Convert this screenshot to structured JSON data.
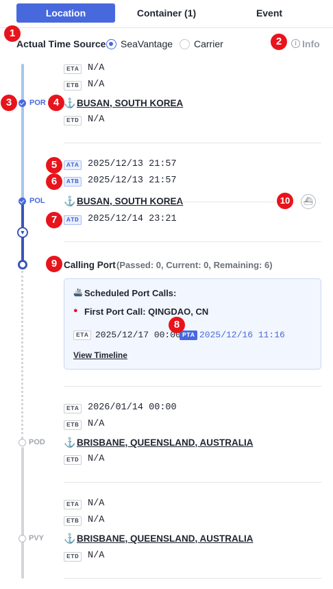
{
  "tabs": [
    {
      "label": "Location",
      "active": true
    },
    {
      "label": "Container (1)",
      "active": false
    },
    {
      "label": "Event",
      "active": false
    }
  ],
  "time_source": {
    "label": "Actual Time Source:",
    "options": [
      {
        "label": "SeaVantage",
        "selected": true
      },
      {
        "label": "Carrier",
        "selected": false
      }
    ],
    "info_label": "Info",
    "info_icon": "info-circle-icon"
  },
  "markers": [
    "1",
    "2",
    "3",
    "4",
    "5",
    "6",
    "7",
    "8",
    "9",
    "10"
  ],
  "stages": {
    "por": {
      "label": "POR",
      "rows": [
        {
          "badge": "ETA",
          "value": "N/A"
        },
        {
          "badge": "ETB",
          "value": "N/A"
        }
      ],
      "port": "BUSAN, SOUTH KOREA",
      "after": [
        {
          "badge": "ETD",
          "value": "N/A"
        }
      ]
    },
    "pol": {
      "label": "POL",
      "rows": [
        {
          "badge": "ATA",
          "value": "2025/12/13 21:57"
        },
        {
          "badge": "ATB",
          "value": "2025/12/13 21:57"
        }
      ],
      "port": "BUSAN, SOUTH KOREA",
      "after": [
        {
          "badge": "ATD",
          "value": "2025/12/14 23:21"
        }
      ]
    },
    "pod": {
      "label": "POD",
      "rows": [
        {
          "badge": "ETA",
          "value": "2026/01/14 00:00"
        },
        {
          "badge": "ETB",
          "value": "N/A"
        }
      ],
      "port": "BRISBANE, QUEENSLAND, AUSTRALIA",
      "after": [
        {
          "badge": "ETD",
          "value": "N/A"
        }
      ]
    },
    "pvy": {
      "label": "PVY",
      "rows": [
        {
          "badge": "ETA",
          "value": "N/A"
        },
        {
          "badge": "ETB",
          "value": "N/A"
        }
      ],
      "port": "BRISBANE, QUEENSLAND, AUSTRALIA",
      "after": [
        {
          "badge": "ETD",
          "value": "N/A"
        }
      ]
    }
  },
  "calling_port": {
    "title": "Calling Port",
    "meta": "(Passed: 0, Current: 0, Remaining: 6)",
    "scheduled_label": "Scheduled Port Calls:",
    "first_call": "First Port Call: QINGDAO, CN",
    "eta_badge": "ETA",
    "eta_value": "2025/12/17 00:00",
    "pta_badge": "PTA",
    "pta_value": "2025/12/16 11:16",
    "view_timeline": "View Timeline"
  },
  "icons": {
    "anchor": "anchor-icon",
    "ship": "ship-icon",
    "pin": "map-pin-icon",
    "scheduled": "ship-emoji-icon",
    "expand": "chevron-down-icon"
  },
  "colors": {
    "accent": "#4869dd",
    "marker": "#e8141c",
    "timeline_light": "#a9c4ee",
    "timeline_dark": "#3a55b6",
    "timeline_grey": "#d2d5da"
  }
}
